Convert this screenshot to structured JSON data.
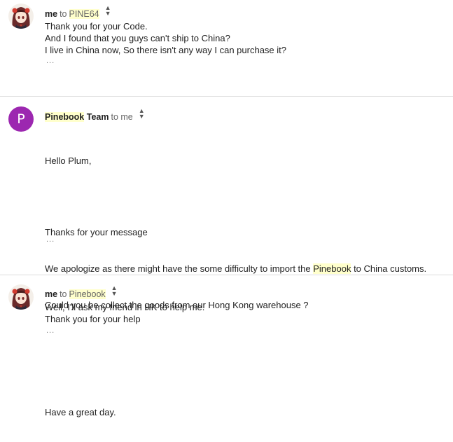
{
  "messages": [
    {
      "sender": "me",
      "to_word": "to",
      "recipient": "PINE64",
      "avatar": "anime-character-avatar",
      "lines": [
        "Thank you for your Code.",
        "And I found that you guys can't ship to China?",
        "I live in China now, So there isn't any way I can purchase it?"
      ],
      "more": "..."
    },
    {
      "sender_highlight": "Pinebook",
      "sender_rest": " Team",
      "to_word": "to me",
      "avatar_letter": "P",
      "lines": [
        "Hello Plum,",
        "",
        "Thanks for your message",
        "We apologize as there might have the some difficulty to import the ",
        "Pinebook",
        " to China customs.",
        "Could you be collect the goods from our Hong Kong warehouse ?",
        "",
        "",
        "Have a great day."
      ],
      "more": "..."
    },
    {
      "sender": "me",
      "to_word": "to",
      "recipient": "Pinebook",
      "avatar": "anime-character-avatar",
      "lines": [
        "Well, I'll ask my friend in HK to help me.",
        "Thank you for your help"
      ],
      "more": "..."
    }
  ],
  "icons": {
    "details_caret": "caret-updown-icon"
  },
  "colors": {
    "avatar_purple": "#9c27b0",
    "highlight": "#ffffcc"
  }
}
